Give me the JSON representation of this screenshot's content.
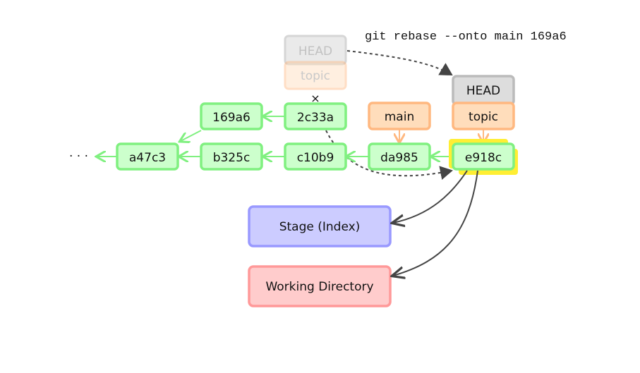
{
  "command": "git rebase --onto main 169a6",
  "ellipsis": "· · ·",
  "commits": {
    "a47c3": "a47c3",
    "b325c": "b325c",
    "c10b9": "c10b9",
    "da985": "da985",
    "e918c": "e918c",
    "169a6": "169a6",
    "2c33a": "2c33a"
  },
  "refs": {
    "old_head": "HEAD",
    "old_topic": "topic",
    "main": "main",
    "new_head": "HEAD",
    "new_topic": "topic",
    "removed_marker": "×"
  },
  "areas": {
    "stage": "Stage (Index)",
    "working": "Working Directory"
  },
  "colors": {
    "commit_fill": "#ccffcc",
    "commit_stroke": "#80f080",
    "branch_fill": "#ffddbb",
    "branch_stroke": "#ffb880",
    "head_fill": "#dddddd",
    "head_stroke": "#bbbbbb",
    "stage_fill": "#ccccff",
    "stage_stroke": "#9999ff",
    "working_fill": "#ffcccc",
    "working_stroke": "#ff9999",
    "highlight": "#ffee33",
    "arrow_dark": "#444444"
  }
}
